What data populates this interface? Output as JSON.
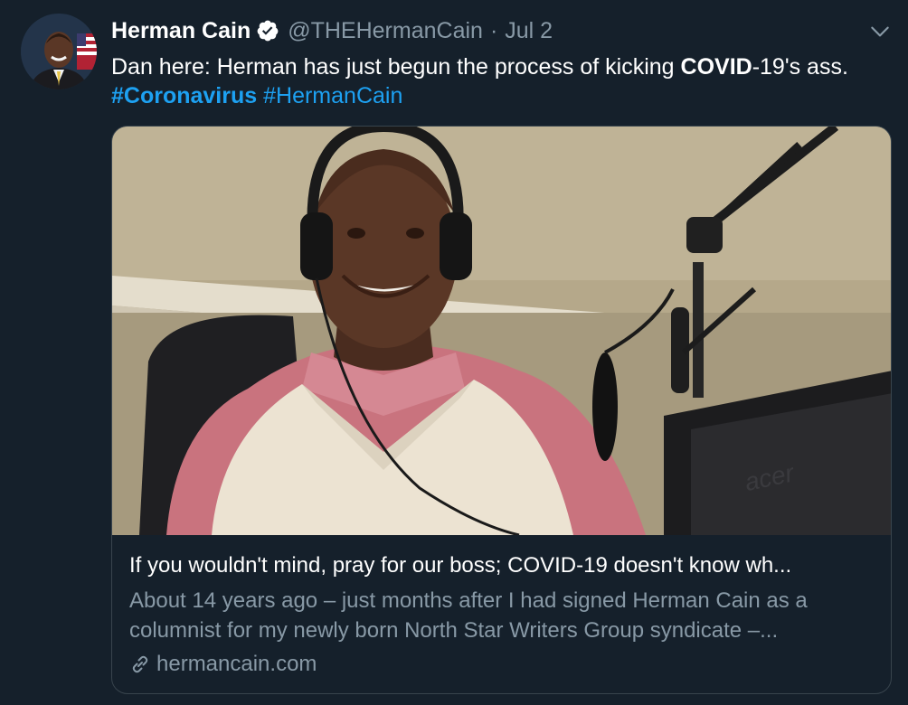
{
  "tweet": {
    "author_name": "Herman Cain",
    "handle": "@THEHermanCain",
    "separator": "·",
    "date": "Jul 2",
    "text_part1": "Dan here: Herman has just begun the process of kicking ",
    "text_bold": "COVID",
    "text_part2": "-19's ass. ",
    "hashtag1": "#Coronavirus",
    "hashtag2": "#HermanCain"
  },
  "card": {
    "title": "If you wouldn't mind, pray for our boss; COVID-19 doesn't know wh...",
    "description": "About 14 years ago – just months after I had signed Herman Cain as a columnist for my newly born North Star Writers Group syndicate –...",
    "domain": "hermancain.com",
    "image_text": "acer"
  },
  "colors": {
    "background": "#15202b",
    "accent": "#1da1f2",
    "secondary_text": "#8899a6",
    "border": "#38444d"
  },
  "icons": [
    "verified-badge-icon",
    "chevron-down-icon",
    "link-icon"
  ]
}
